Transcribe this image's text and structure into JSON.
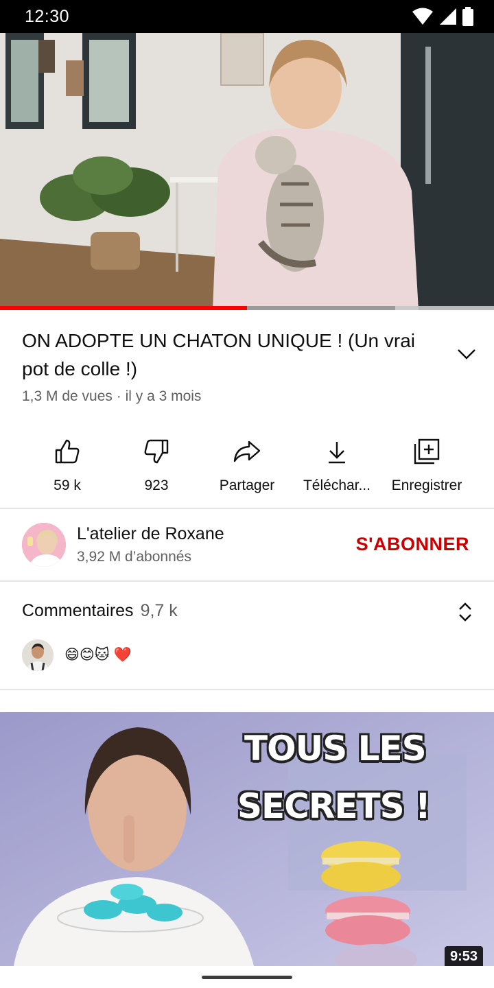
{
  "status_bar": {
    "time": "12:30",
    "icons": [
      "wifi-icon",
      "cellular-signal-icon",
      "battery-icon"
    ]
  },
  "player": {
    "progress_played_fraction": 0.5,
    "progress_buffered_fraction": 0.8
  },
  "video": {
    "title": "ON ADOPTE UN CHATON UNIQUE ! (Un vrai pot de colle !)",
    "meta": "1,3 M de vues · il y a 3 mois"
  },
  "actions": [
    {
      "label": "59 k",
      "icon": "thumbs-up-icon"
    },
    {
      "label": "923",
      "icon": "thumbs-down-icon"
    },
    {
      "label": "Partager",
      "icon": "share-icon"
    },
    {
      "label": "Téléchar...",
      "icon": "download-icon"
    },
    {
      "label": "Enregistrer",
      "icon": "save-playlist-icon"
    }
  ],
  "channel": {
    "name": "L'atelier de Roxane",
    "subscribers": "3,92 M d’abonnés",
    "subscribe_label": "S'ABONNER",
    "subscribe_color": "#cc0000"
  },
  "comments": {
    "title": "Commentaires",
    "count": "9,7 k",
    "preview_text": "😄😊🐱 ❤️"
  },
  "next_video": {
    "overlay_line1": "TOUS LES",
    "overlay_line2": "SECRETS !",
    "duration": "9:53"
  },
  "colors": {
    "accent": "#ff0000",
    "text_primary": "#0f0f0f",
    "text_secondary": "#606060"
  }
}
